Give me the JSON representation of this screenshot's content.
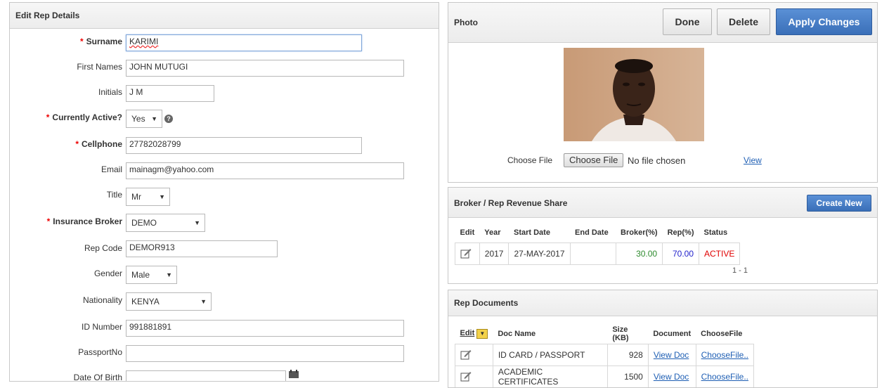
{
  "edit_rep": {
    "title": "Edit Rep Details",
    "fields": {
      "surname": {
        "label": "Surname",
        "value": "KARIMI"
      },
      "first_names": {
        "label": "First Names",
        "value": "JOHN MUTUGI"
      },
      "initials": {
        "label": "Initials",
        "value": "J M"
      },
      "currently_active": {
        "label": "Currently Active?",
        "value": "Yes"
      },
      "cellphone": {
        "label": "Cellphone",
        "value": "27782028799"
      },
      "email": {
        "label": "Email",
        "value": "mainagm@yahoo.com"
      },
      "title": {
        "label": "Title",
        "value": "Mr"
      },
      "insurance_broker": {
        "label": "Insurance Broker",
        "value": "DEMO"
      },
      "rep_code": {
        "label": "Rep Code",
        "value": "DEMOR913"
      },
      "gender": {
        "label": "Gender",
        "value": "Male"
      },
      "nationality": {
        "label": "Nationality",
        "value": "KENYA"
      },
      "id_number": {
        "label": "ID Number",
        "value": "991881891"
      },
      "passport_no": {
        "label": "PassportNo",
        "value": ""
      },
      "date_of_birth": {
        "label": "Date Of Birth",
        "value": ""
      }
    },
    "required_mark": "*",
    "help_glyph": "?"
  },
  "photo": {
    "title": "Photo",
    "done_label": "Done",
    "delete_label": "Delete",
    "apply_label": "Apply Changes",
    "choose_file_label": "Choose File",
    "choose_file_button": "Choose File",
    "no_file": "No file chosen",
    "view_link": "View"
  },
  "revenue_share": {
    "title": "Broker / Rep Revenue Share",
    "create_label": "Create New",
    "columns": [
      "Edit",
      "Year",
      "Start Date",
      "End Date",
      "Broker(%)",
      "Rep(%)",
      "Status"
    ],
    "rows": [
      {
        "year": "2017",
        "start_date": "27-MAY-2017",
        "end_date": "",
        "broker": "30.00",
        "rep": "70.00",
        "status": "ACTIVE"
      }
    ],
    "pagination": "1 - 1"
  },
  "rep_documents": {
    "title": "Rep Documents",
    "columns": [
      "Edit",
      "Doc Name",
      "Size (KB)",
      "Document",
      "ChooseFile"
    ],
    "rows": [
      {
        "doc_name": "ID CARD / PASSPORT",
        "size": "928",
        "document": "View Doc",
        "choose": "ChooseFile.."
      },
      {
        "doc_name": "ACADEMIC CERTIFICATES",
        "size": "1500",
        "document": "View Doc",
        "choose": "ChooseFile.."
      }
    ]
  },
  "colors": {
    "required": "#e00000",
    "primary_button": "#3a6fb8",
    "broker_value": "#2e8b2e",
    "rep_value": "#2222cc",
    "status_active": "#e00000",
    "link": "#1f5fb4"
  }
}
